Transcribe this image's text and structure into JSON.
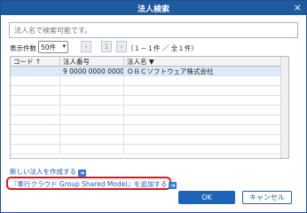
{
  "window": {
    "title": "法人検索",
    "close_glyph": "×"
  },
  "search": {
    "placeholder": "法人名で検索可能です。"
  },
  "paging": {
    "count_label": "表示件数",
    "page_size": "50件",
    "prev_glyph": "‹",
    "next_glyph": "›",
    "current_page": "1",
    "info": "（１－１件 ／ 全１件）"
  },
  "table": {
    "columns": [
      "コード ↑",
      "法人番号",
      "法人名 ▼"
    ],
    "rows": [
      [
        "",
        "9 0000 0000 0000",
        "ＯＢＣソフトウェア株式会社"
      ]
    ]
  },
  "links": {
    "create_new": "新しい法人を作成する",
    "add_shared": "『奉行クラウド Group Shared Model』を追加する"
  },
  "buttons": {
    "ok": "OK",
    "cancel": "キャンセル"
  },
  "colors": {
    "accent": "#1f5aa0",
    "highlight": "#e0161b"
  }
}
